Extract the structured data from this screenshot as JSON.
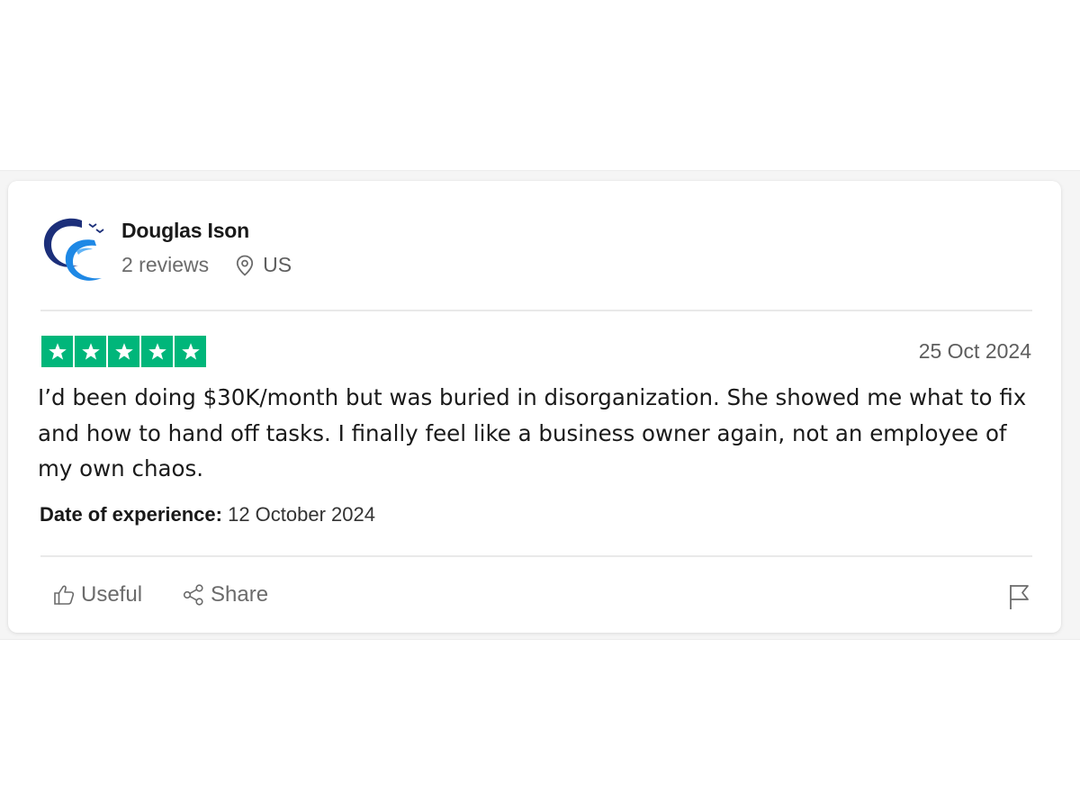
{
  "reviewer": {
    "name": "Douglas Ison",
    "review_count": "2 reviews",
    "country": "US",
    "avatar_icon": "company-logo-icon"
  },
  "review": {
    "rating": 5,
    "max_rating": 5,
    "star_color": "#00b67a",
    "date": "25 Oct 2024",
    "text": "I’d been doing $30K/month but was buried in disorganization. She showed me what to fix and how to hand off tasks. I finally feel like a business owner again, not an employee of my own chaos.",
    "experience_label": "Date of experience:",
    "experience_date": "12 October 2024"
  },
  "actions": {
    "useful_label": "Useful",
    "useful_icon": "thumbs-up-icon",
    "share_label": "Share",
    "share_icon": "share-icon",
    "report_icon": "flag-icon"
  }
}
